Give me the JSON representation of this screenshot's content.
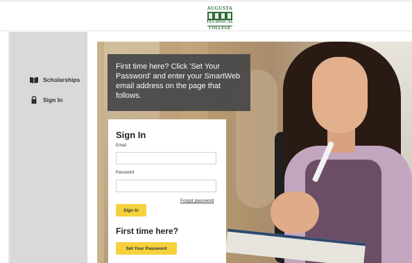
{
  "header": {
    "logo": {
      "line1": "AUGUSTA",
      "line2": "TECHNICAL",
      "line3": "COLLEGE",
      "color": "#2f6b3a"
    }
  },
  "sidebar": {
    "items": [
      {
        "label": "Scholarships",
        "icon": "book-icon"
      },
      {
        "label": "Sign In",
        "icon": "padlock-icon"
      }
    ]
  },
  "hero": {
    "callout": "First time here? Click 'Set Your Password' and enter your SmartWeb email address on the page that follows."
  },
  "signin": {
    "title": "Sign In",
    "email_label": "Email",
    "email_value": "",
    "password_label": "Password",
    "password_value": "",
    "forgot_label": "Forgot password",
    "signin_button": "Sign In",
    "first_time_title": "First time here?",
    "set_password_button": "Set Your Password"
  },
  "colors": {
    "accent": "#f5d13d",
    "sidebar": "#d9d9d9",
    "callout": "#4a4a4a"
  }
}
